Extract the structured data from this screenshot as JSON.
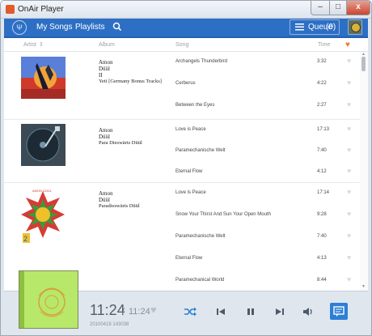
{
  "window": {
    "title": "OnAir Player",
    "minimize": "–",
    "maximize": "□",
    "close": "x"
  },
  "nav": {
    "songs": "My Songs",
    "playlists": "Playlists",
    "queue_label": "Queue",
    "queue_count": "(0)"
  },
  "header": {
    "artist": "Artist",
    "sort": "⇕",
    "album": "Album",
    "song": "Song",
    "time": "Time",
    "heart": "♥"
  },
  "albums": [
    {
      "line1": "Amon",
      "line2": "Düül",
      "line3": "II",
      "title": "Yeti [Germany Bonus Tracks]",
      "songs": [
        {
          "name": "Archangels Thunderbird",
          "time": "3:32"
        },
        {
          "name": "Cerberus",
          "time": "4:22"
        },
        {
          "name": "Between the Eyes",
          "time": "2:27"
        }
      ]
    },
    {
      "line1": "Amon",
      "line2": "Düül",
      "line3": "",
      "title": "Para Dieswärts Düül",
      "songs": [
        {
          "name": "Love is Peace",
          "time": "17:13"
        },
        {
          "name": "Paramechanische Welt",
          "time": "7:40"
        },
        {
          "name": "Eternal Flow",
          "time": "4:12"
        }
      ]
    },
    {
      "line1": "Amon",
      "line2": "Düül",
      "line3": "",
      "title": "Paradieswärts Düül",
      "art_text": "AMON DÜÜL",
      "songs": [
        {
          "name": "Love is Peace",
          "time": "17:14"
        },
        {
          "name": "Snow Your Thirst And Sun Your Open Mouth",
          "time": "9:28"
        },
        {
          "name": "Paramechanische Welt",
          "time": "7:40"
        },
        {
          "name": "Eternal Flow",
          "time": "4:13"
        },
        {
          "name": "Paramechanical World",
          "time": "8:44"
        }
      ]
    }
  ],
  "player": {
    "current": "11:24",
    "separator": "/",
    "total": "11:24",
    "stamp": "20100418 143038"
  },
  "colors": {
    "accent": "#2d6fc4",
    "heart_active": "#f07c2e",
    "lyrics_button": "#2d7fd6"
  }
}
